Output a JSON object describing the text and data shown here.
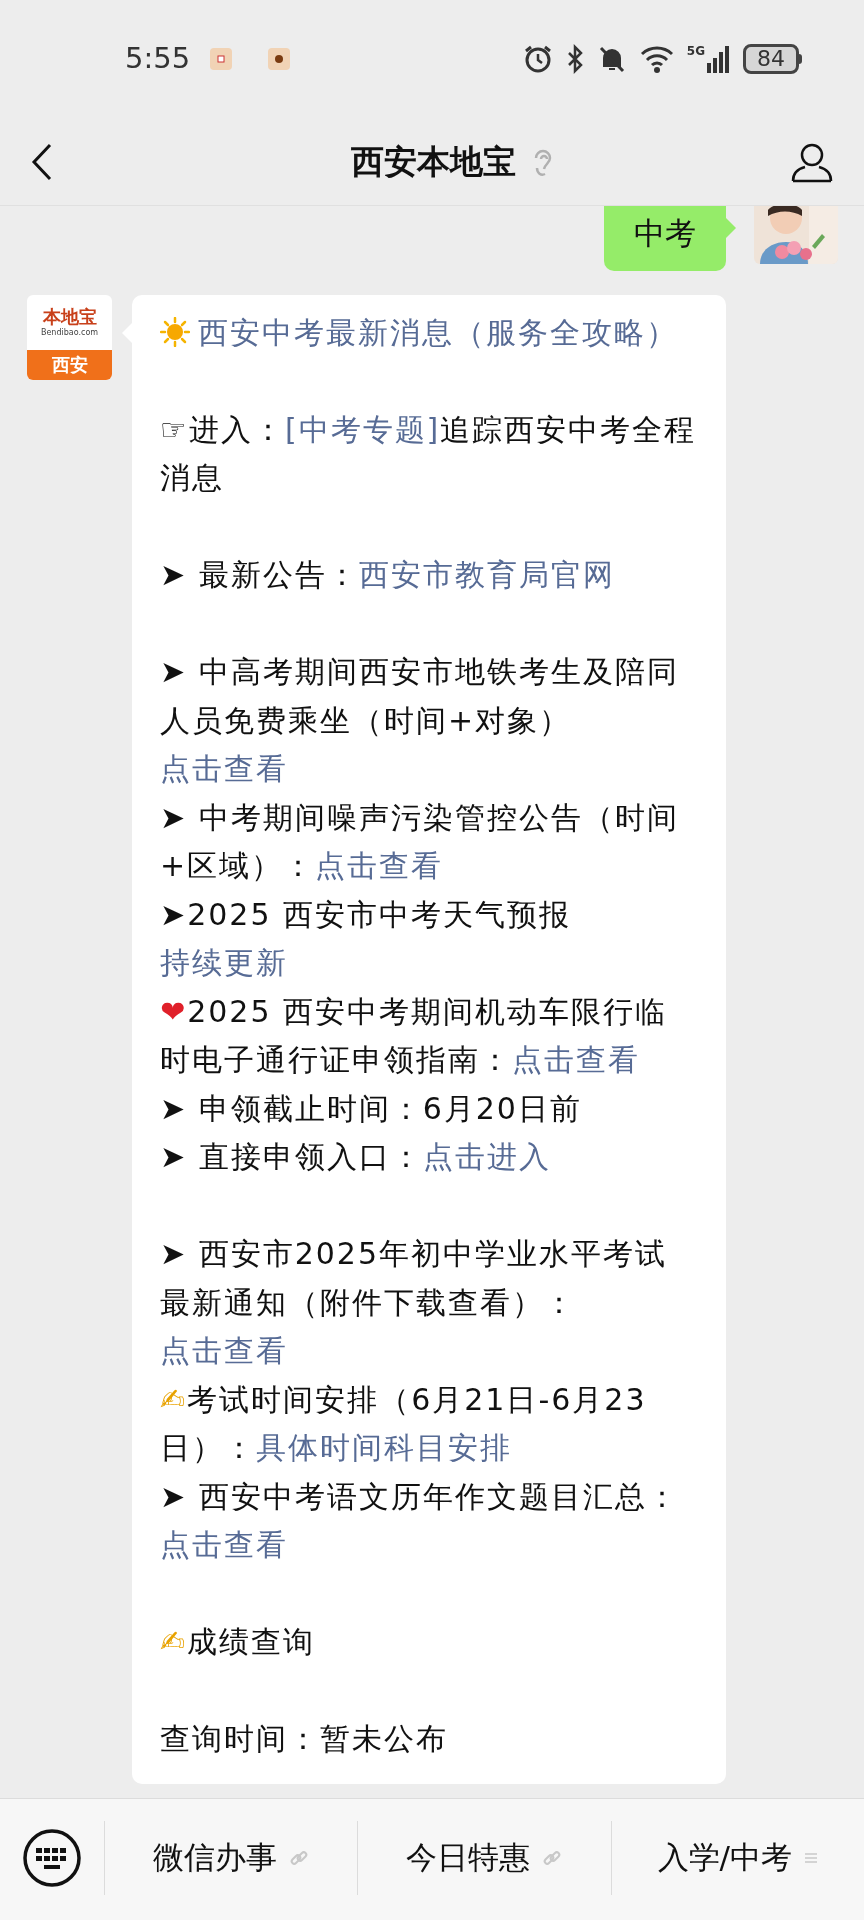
{
  "status_bar": {
    "time": "5:55",
    "battery": "84",
    "network": "5G"
  },
  "header": {
    "title": "西安本地宝"
  },
  "sent_message": {
    "text": "中考"
  },
  "sender_logo": {
    "brand": "本地宝",
    "site": "Bendibao.com",
    "city": "西安"
  },
  "message": {
    "blocks": [
      [
        [
          {
            "kind": "sun"
          },
          {
            "kind": "link",
            "text": "西安中考最新消息（服务全攻略）"
          }
        ]
      ],
      [
        [
          {
            "kind": "text",
            "text": "☞进入："
          },
          {
            "kind": "link",
            "text": "[中考专题]"
          },
          {
            "kind": "text",
            "text": "追踪西安中考全程消息"
          }
        ]
      ],
      [
        [
          {
            "kind": "text",
            "text": "➤ 最新公告："
          },
          {
            "kind": "link",
            "text": "西安市教育局官网"
          }
        ]
      ],
      [
        [
          {
            "kind": "text",
            "text": "➤ 中高考期间西安市地铁考生及陪同人员免费乘坐（时间+对象）"
          },
          {
            "kind": "link",
            "text": "点击查看"
          }
        ],
        [
          {
            "kind": "text",
            "text": "➤ 中考期间噪声污染管控公告（时间+区域）："
          },
          {
            "kind": "link",
            "text": "点击查看"
          }
        ],
        [
          {
            "kind": "text",
            "text": "➤2025 西安市中考天气预报"
          },
          {
            "kind": "link",
            "text": "持续更新"
          }
        ],
        [
          {
            "kind": "emoji",
            "text": "❤",
            "color": "#e0202a"
          },
          {
            "kind": "text",
            "text": "2025 西安中考期间机动车限行临时电子通行证申领指南："
          },
          {
            "kind": "link",
            "text": "点击查看"
          }
        ],
        [
          {
            "kind": "text",
            "text": "➤ 申领截止时间：6月20日前"
          }
        ],
        [
          {
            "kind": "text",
            "text": "➤ 直接申领入口："
          },
          {
            "kind": "link",
            "text": "点击进入"
          }
        ]
      ],
      [
        [
          {
            "kind": "text",
            "text": "➤ 西安市2025年初中学业水平考试最新通知（附件下载查看）："
          },
          {
            "kind": "link",
            "text": "点击查看"
          }
        ],
        [
          {
            "kind": "emoji",
            "text": "✍",
            "color": "#e8a200"
          },
          {
            "kind": "text",
            "text": "考试时间安排（6月21日-6月23日）："
          },
          {
            "kind": "link",
            "text": "具体时间科目安排"
          }
        ],
        [
          {
            "kind": "text",
            "text": "➤ 西安中考语文历年作文题目汇总："
          },
          {
            "kind": "link",
            "text": "点击查看"
          }
        ]
      ],
      [
        [
          {
            "kind": "emoji",
            "text": "✍",
            "color": "#e8a200"
          },
          {
            "kind": "text",
            "text": "成绩查询"
          }
        ]
      ],
      [
        [
          {
            "kind": "text",
            "text": "查询时间：暂未公布"
          }
        ]
      ]
    ]
  },
  "menu": [
    {
      "label": "微信办事",
      "kind": "link"
    },
    {
      "label": "今日特惠",
      "kind": "link"
    },
    {
      "label": "入学/中考",
      "kind": "submenu"
    }
  ]
}
